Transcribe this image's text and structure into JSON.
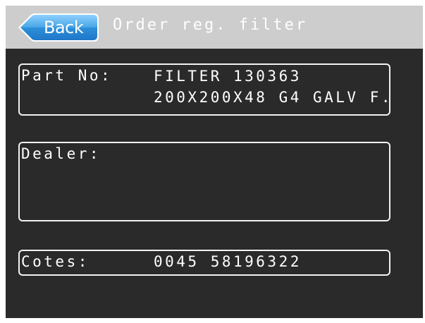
{
  "header": {
    "back_label": "Back",
    "title": "Order reg. filter"
  },
  "fields": {
    "part_no": {
      "label": "Part No:",
      "line1": "FILTER 130363",
      "line2": "200X200X48 G4 GALV F."
    },
    "dealer": {
      "label": "Dealer:",
      "value": ""
    },
    "cotes": {
      "label": "Cotes:",
      "value": "0045 58196322"
    }
  },
  "colors": {
    "screen_background": "#2a2a2a",
    "header_background": "#cdcdcd",
    "back_button_blue": "#4a9fdc",
    "text": "#ffffff",
    "border": "#f2f2f2"
  },
  "icons": {
    "back": "back-arrow-button"
  }
}
